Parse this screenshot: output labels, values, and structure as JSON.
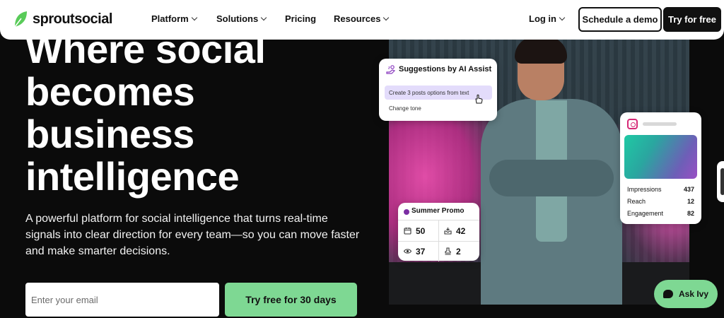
{
  "brand": {
    "logo_text": "sproutsocial",
    "accent": "#7ed893",
    "logo_green": "#59cb59"
  },
  "nav": {
    "items": [
      {
        "label": "Platform",
        "has_menu": true
      },
      {
        "label": "Solutions",
        "has_menu": true
      },
      {
        "label": "Pricing",
        "has_menu": false
      },
      {
        "label": "Resources",
        "has_menu": true
      }
    ],
    "login": "Log in",
    "demo": "Schedule a demo",
    "try": "Try for free"
  },
  "hero": {
    "headline": [
      "Where social",
      "becomes",
      "business",
      "intelligence"
    ],
    "subtext": "A powerful platform for social intelligence that turns real-time signals into clear direction for every team—so you can move faster and make smarter decisions.",
    "email_placeholder": "Enter your email",
    "cta": "Try free for 30 days"
  },
  "ai_card": {
    "title": "Suggestions by AI Assist",
    "option_selected": "Create 3 posts options from text",
    "option_2": "Change tone"
  },
  "instagram_card": {
    "icon": "instagram-icon",
    "stats": [
      {
        "label": "Impressions",
        "value": "437"
      },
      {
        "label": "Reach",
        "value": "12"
      },
      {
        "label": "Engagement",
        "value": "82"
      }
    ]
  },
  "promo_card": {
    "title": "Summer Promo",
    "dot_color": "#7b2ea3",
    "stats": [
      {
        "icon": "calendar-icon",
        "value": "50"
      },
      {
        "icon": "inbox-icon",
        "value": "42"
      },
      {
        "icon": "eye-icon",
        "value": "37"
      },
      {
        "icon": "stamp-icon",
        "value": "2"
      }
    ]
  },
  "chat": {
    "label": "Ask Ivy"
  }
}
